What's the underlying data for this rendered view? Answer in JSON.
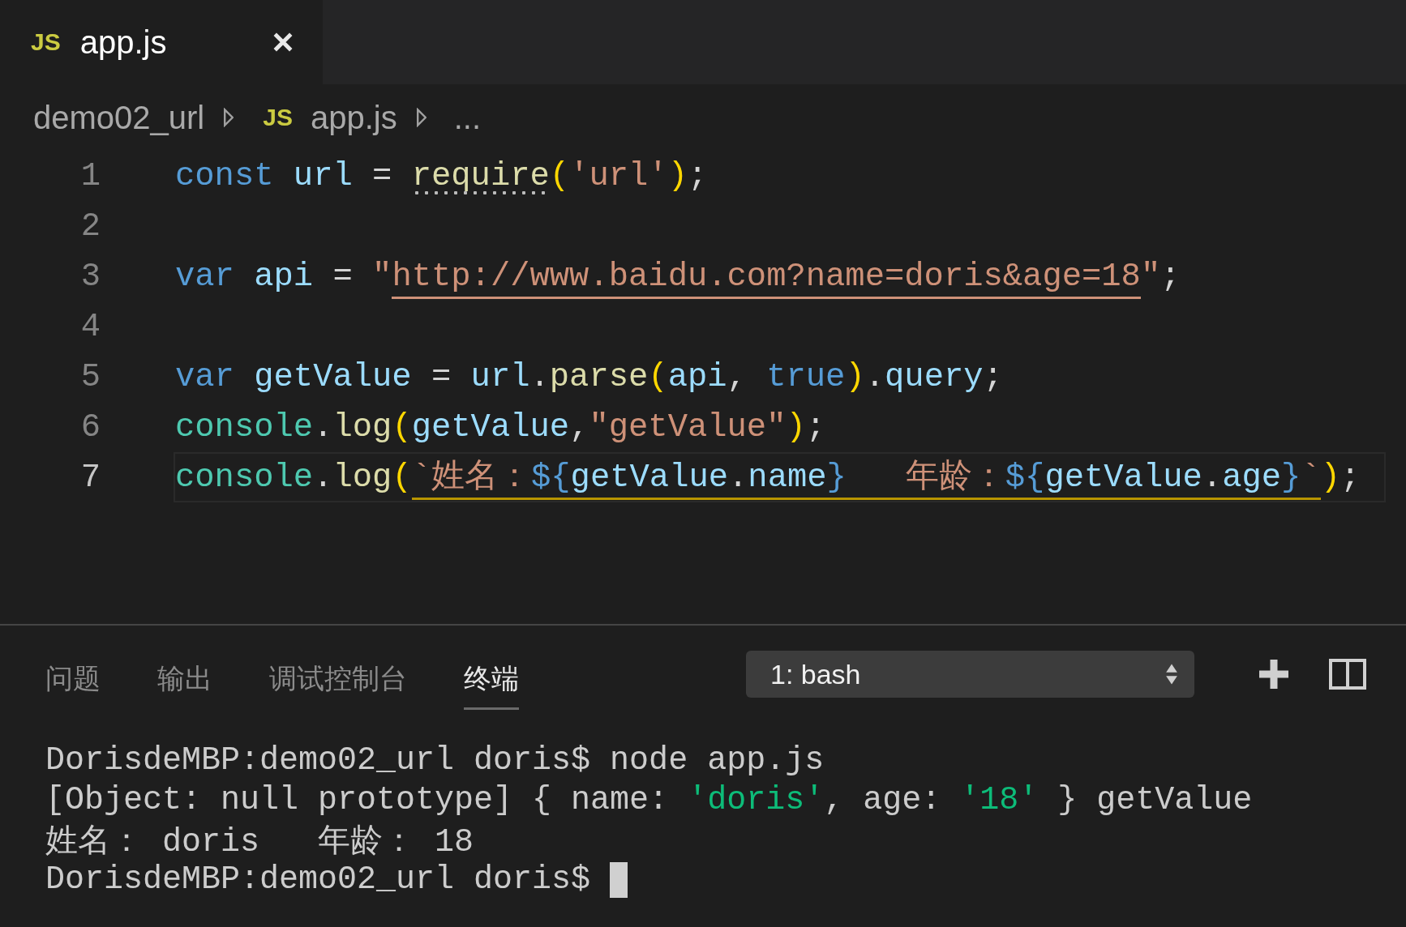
{
  "tabs": [
    {
      "badge": "JS",
      "label": "app.js",
      "selected": true
    }
  ],
  "breadcrumbs": [
    {
      "label": "demo02_url"
    },
    {
      "badge": "JS",
      "label": "app.js"
    },
    {
      "label": "..."
    }
  ],
  "code_lines": [
    {
      "number": "1",
      "current": false,
      "tokens": [
        {
          "text": "const ",
          "kind": "keyword"
        },
        {
          "text": "url",
          "kind": "variable"
        },
        {
          "text": " = ",
          "kind": "plain"
        },
        {
          "text": "require",
          "kind": "function",
          "hint": true
        },
        {
          "text": "(",
          "kind": "paren"
        },
        {
          "text": "'url'",
          "kind": "string"
        },
        {
          "text": ")",
          "kind": "paren"
        },
        {
          "text": ";",
          "kind": "plain"
        }
      ]
    },
    {
      "number": "2",
      "current": false
    },
    {
      "number": "3",
      "current": false,
      "tokens": [
        {
          "text": "var ",
          "kind": "keyword"
        },
        {
          "text": "api",
          "kind": "variable"
        },
        {
          "text": " = ",
          "kind": "plain"
        },
        {
          "text": "\"",
          "kind": "string"
        },
        {
          "text": "http://www.baidu.com?name=doris&age=18",
          "kind": "string",
          "underline": true
        },
        {
          "text": "\"",
          "kind": "string"
        },
        {
          "text": ";",
          "kind": "plain"
        }
      ]
    },
    {
      "number": "4",
      "current": false
    },
    {
      "number": "5",
      "current": false,
      "tokens": [
        {
          "text": "var ",
          "kind": "keyword"
        },
        {
          "text": "getValue",
          "kind": "variable"
        },
        {
          "text": " = ",
          "kind": "plain"
        },
        {
          "text": "url",
          "kind": "variable"
        },
        {
          "text": ".",
          "kind": "plain"
        },
        {
          "text": "parse",
          "kind": "function"
        },
        {
          "text": "(",
          "kind": "paren"
        },
        {
          "text": "api",
          "kind": "variable"
        },
        {
          "text": ", ",
          "kind": "plain"
        },
        {
          "text": "true",
          "kind": "keyword"
        },
        {
          "text": ")",
          "kind": "paren"
        },
        {
          "text": ".",
          "kind": "plain"
        },
        {
          "text": "query",
          "kind": "variable"
        },
        {
          "text": ";",
          "kind": "plain"
        }
      ]
    },
    {
      "number": "6",
      "current": false,
      "tokens": [
        {
          "text": "console",
          "kind": "class"
        },
        {
          "text": ".",
          "kind": "plain"
        },
        {
          "text": "log",
          "kind": "function"
        },
        {
          "text": "(",
          "kind": "paren"
        },
        {
          "text": "getValue",
          "kind": "variable"
        },
        {
          "text": ",",
          "kind": "plain"
        },
        {
          "text": "\"getValue\"",
          "kind": "string"
        },
        {
          "text": ")",
          "kind": "paren"
        },
        {
          "text": ";",
          "kind": "plain"
        }
      ]
    },
    {
      "number": "7",
      "current": true,
      "warning": true,
      "tokens": [
        {
          "text": "console",
          "kind": "class"
        },
        {
          "text": ".",
          "kind": "plain"
        },
        {
          "text": "log",
          "kind": "function"
        },
        {
          "text": "(",
          "kind": "paren"
        },
        {
          "text": "`姓名：",
          "kind": "string",
          "underline": true
        },
        {
          "text": "${",
          "kind": "keyword",
          "underline": true
        },
        {
          "text": "getValue",
          "kind": "variable",
          "underline": true
        },
        {
          "text": ".",
          "kind": "plain",
          "underline": true
        },
        {
          "text": "name",
          "kind": "variable",
          "underline": true
        },
        {
          "text": "}",
          "kind": "keyword",
          "underline": true
        },
        {
          "text": "   年龄：",
          "kind": "string",
          "underline": true
        },
        {
          "text": "${",
          "kind": "keyword",
          "underline": true
        },
        {
          "text": "getValue",
          "kind": "variable",
          "underline": true
        },
        {
          "text": ".",
          "kind": "plain",
          "underline": true
        },
        {
          "text": "age",
          "kind": "variable",
          "underline": true
        },
        {
          "text": "}",
          "kind": "keyword",
          "underline": true
        },
        {
          "text": "`",
          "kind": "string",
          "underline": true
        },
        {
          "text": ")",
          "kind": "paren"
        },
        {
          "text": ";",
          "kind": "plain"
        }
      ]
    }
  ],
  "panel": {
    "tabs": [
      {
        "label": "问题",
        "selected": false
      },
      {
        "label": "输出",
        "selected": false
      },
      {
        "label": "调试控制台",
        "selected": false
      },
      {
        "label": "终端",
        "selected": true
      }
    ],
    "terminal_select": "1: bash",
    "terminal_lines": [
      {
        "cursor": false,
        "tokens": [
          {
            "text": "DorisdeMBP:demo02_url doris$ node app.js",
            "kind": "plain"
          }
        ]
      },
      {
        "cursor": false,
        "tokens": [
          {
            "text": "[Object: null prototype] { name: ",
            "kind": "plain"
          },
          {
            "text": "'doris'",
            "kind": "string"
          },
          {
            "text": ", age: ",
            "kind": "plain"
          },
          {
            "text": "'18'",
            "kind": "string"
          },
          {
            "text": " } getValue",
            "kind": "plain"
          }
        ]
      },
      {
        "cursor": false,
        "tokens": [
          {
            "text": "姓名： doris   年龄： 18",
            "kind": "plain"
          }
        ]
      },
      {
        "cursor": true,
        "tokens": [
          {
            "text": "DorisdeMBP:demo02_url doris$ ",
            "kind": "plain"
          }
        ]
      }
    ]
  }
}
